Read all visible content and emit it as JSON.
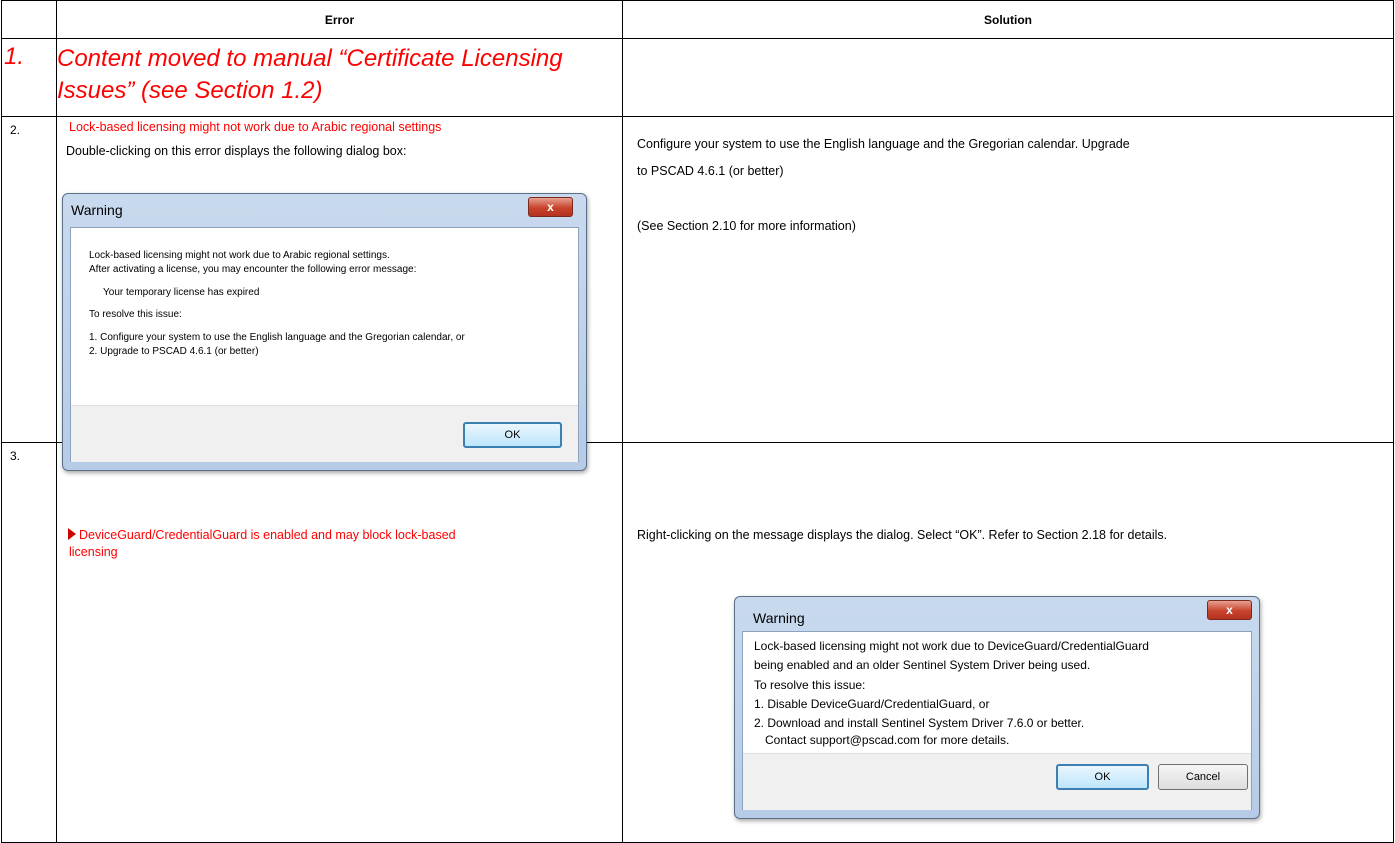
{
  "table": {
    "headers": {
      "error": "Error",
      "solution": "Solution"
    },
    "rows": [
      {
        "number": "1.",
        "error_text": "Content moved to manual “Certificate Licensing Issues” (see Section 1.2)",
        "solution_text": ""
      },
      {
        "number": "2.",
        "error_title": "Lock-based licensing might not work due to Arabic regional settings",
        "error_desc": "Double-clicking on this error displays the following dialog box:",
        "solution_line1": "Configure your system to use the English language and the Gregorian calendar. Upgrade",
        "solution_line2": "to PSCAD 4.6.1 (or better)",
        "solution_line3": "(See Section 2.10 for more information)",
        "dialog": {
          "title": "Warning",
          "close": "x",
          "lines": [
            "Lock-based licensing might not work due to Arabic regional settings.",
            "After activating a license, you may encounter the following error message:",
            "Your temporary license has expired",
            "To resolve this issue:",
            "1. Configure your system to use the English language and the Gregorian calendar, or",
            "2. Upgrade to PSCAD 4.6.1 (or better)"
          ],
          "ok_button": "OK"
        }
      },
      {
        "number": "3.",
        "error_title": "DeviceGuard/CredentialGuard is enabled and may block lock-based",
        "error_title_2": "licensing",
        "solution_text": "Right-clicking on the message displays the dialog. Select “OK”. Refer to Section 2.18 for details.",
        "dialog": {
          "title": "Warning",
          "close": "x",
          "lines": [
            "Lock-based licensing might not work due to DeviceGuard/CredentialGuard",
            "being enabled and an older Sentinel System Driver being used.",
            "To resolve this issue:",
            "1. Disable DeviceGuard/CredentialGuard, or",
            "2. Download and install Sentinel System Driver 7.6.0 or better.",
            "Contact support@pscad.com for more details."
          ],
          "ok_button": "OK",
          "cancel_button": "Cancel"
        }
      }
    ]
  },
  "colors": {
    "error_red": "#ff0000",
    "dialog_frame": "#b5cbe6",
    "close_red": "#c8432d"
  },
  "icons": {
    "flag": "red-triangle-flag-icon"
  }
}
